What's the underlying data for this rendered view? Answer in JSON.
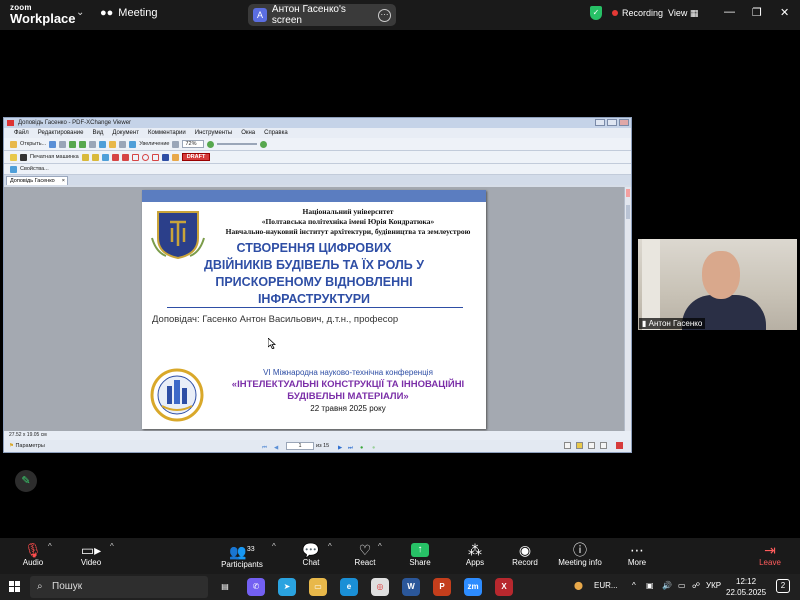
{
  "zoom": {
    "logo_line1": "zoom",
    "logo_line2": "Workplace",
    "meeting_label": "Meeting",
    "screen_share_avatar": "A",
    "screen_share_label": "Антон Гасенко's screen",
    "recording_label": "Recording",
    "view_label": "View",
    "colors": {
      "share_green": "#27c166",
      "recording_red": "#e53935"
    }
  },
  "pdf_viewer": {
    "window_title": "Доповідь Гасенко - PDF-XChange Viewer",
    "menu": [
      "Файл",
      "Редактирование",
      "Вид",
      "Документ",
      "Комментарии",
      "Инструменты",
      "Окна",
      "Справка"
    ],
    "open_label": "Открыть...",
    "zoom_label": "Увеличение",
    "zoom_value": "72%",
    "typewriter_label": "Печатная машинка",
    "draft_stamp": "DRAFT",
    "properties_label": "Свойства...",
    "tab_label": "Доповідь Гасенко",
    "page_size": "27.52 x 19.05 см",
    "params_label": "Параметры",
    "page_current": "1",
    "page_of": "из 15"
  },
  "slide": {
    "header_lines": [
      "Національний університет",
      "«Полтавська політехніка імені Юрія Кондратюка»",
      "Навчально-науковий інститут архітектури, будівництва та землеустрою"
    ],
    "title_lines": [
      "СТВОРЕННЯ ЦИФРОВИХ",
      "ДВІЙНИКІВ БУДІВЕЛЬ ТА ЇХ РОЛЬ У",
      "ПРИСКОРЕНОМУ ВІДНОВЛЕННІ",
      "ІНФРАСТРУКТУРИ"
    ],
    "speaker": "Доповідач: Гасенко Антон Васильович, д.т.н., професор",
    "conference_line1": "VI Міжнародна науково-технічна конференція",
    "conference_line2a": "«ІНТЕЛЕКТУАЛЬНІ КОНСТРУКЦІЇ ТА ІННОВАЦІЙНІ",
    "conference_line2b": "БУДІВЕЛЬНІ МАТЕРІАЛИ»",
    "conference_date": "22 травня 2025 року",
    "colors": {
      "title_blue": "#2e4ea5",
      "conference_purple": "#7b2fa8",
      "band": "#5b7dc0"
    }
  },
  "webcam": {
    "name": "Антон Гасенко"
  },
  "toolbar": {
    "audio": "Audio",
    "video": "Video",
    "participants": "Participants",
    "participants_count": "33",
    "chat": "Chat",
    "react": "React",
    "share": "Share",
    "apps": "Apps",
    "record": "Record",
    "meeting_info": "Meeting info",
    "more": "More",
    "leave": "Leave"
  },
  "taskbar": {
    "search_placeholder": "Пошук",
    "tray_currency": "EUR...",
    "language": "УКР",
    "time": "12:12",
    "date": "22.05.2025",
    "notifications": "2"
  }
}
